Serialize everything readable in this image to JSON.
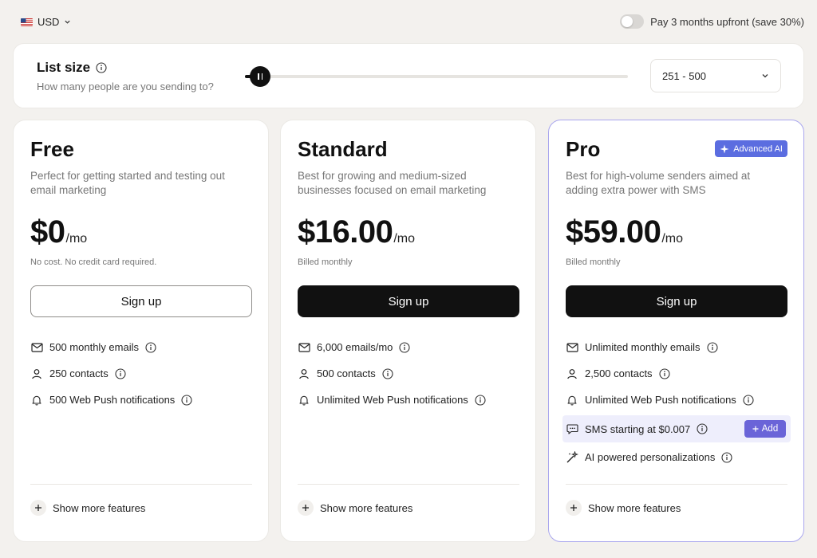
{
  "topbar": {
    "currency": "USD",
    "upfront_label": "Pay 3 months upfront (save 30%)",
    "upfront_enabled": false
  },
  "list_size": {
    "title": "List size",
    "subtitle": "How many people are you sending to?",
    "slider_value_fraction": 0.04,
    "selected_range": "251 - 500"
  },
  "plans": [
    {
      "name": "Free",
      "description": "Perfect for getting started and testing out email marketing",
      "price": "$0",
      "per": "/mo",
      "note": "No cost. No credit card required.",
      "cta": "Sign up",
      "features": [
        {
          "icon": "mail-icon",
          "text": "500 monthly emails"
        },
        {
          "icon": "user-icon",
          "text": "250 contacts"
        },
        {
          "icon": "bell-icon",
          "text": "500 Web Push notifications"
        }
      ],
      "more": "Show more features"
    },
    {
      "name": "Standard",
      "description": "Best for growing and medium-sized businesses focused on email marketing",
      "price": "$16.00",
      "per": "/mo",
      "note": "Billed monthly",
      "cta": "Sign up",
      "features": [
        {
          "icon": "mail-icon",
          "text": "6,000 emails/mo"
        },
        {
          "icon": "user-icon",
          "text": "500 contacts"
        },
        {
          "icon": "bell-icon",
          "text": "Unlimited Web Push notifications"
        }
      ],
      "more": "Show more features"
    },
    {
      "name": "Pro",
      "badge": "Advanced AI",
      "description": "Best for high-volume senders aimed at adding extra power with SMS",
      "price": "$59.00",
      "per": "/mo",
      "note": "Billed monthly",
      "cta": "Sign up",
      "features": [
        {
          "icon": "mail-icon",
          "text": "Unlimited monthly emails"
        },
        {
          "icon": "user-icon",
          "text": "2,500 contacts"
        },
        {
          "icon": "bell-icon",
          "text": "Unlimited Web Push notifications"
        }
      ],
      "sms_feature": {
        "text": "SMS starting at $0.007",
        "add_label": "Add"
      },
      "ai_feature": {
        "text": "AI powered personalizations"
      },
      "more": "Show more features"
    }
  ],
  "colors": {
    "background": "#f3f1ee",
    "primary_button": "#111111",
    "pro_border": "#a9a6ee",
    "ai_badge": "#5b6de0",
    "sms_highlight": "#eeeefc",
    "add_button": "#6a64d8"
  }
}
